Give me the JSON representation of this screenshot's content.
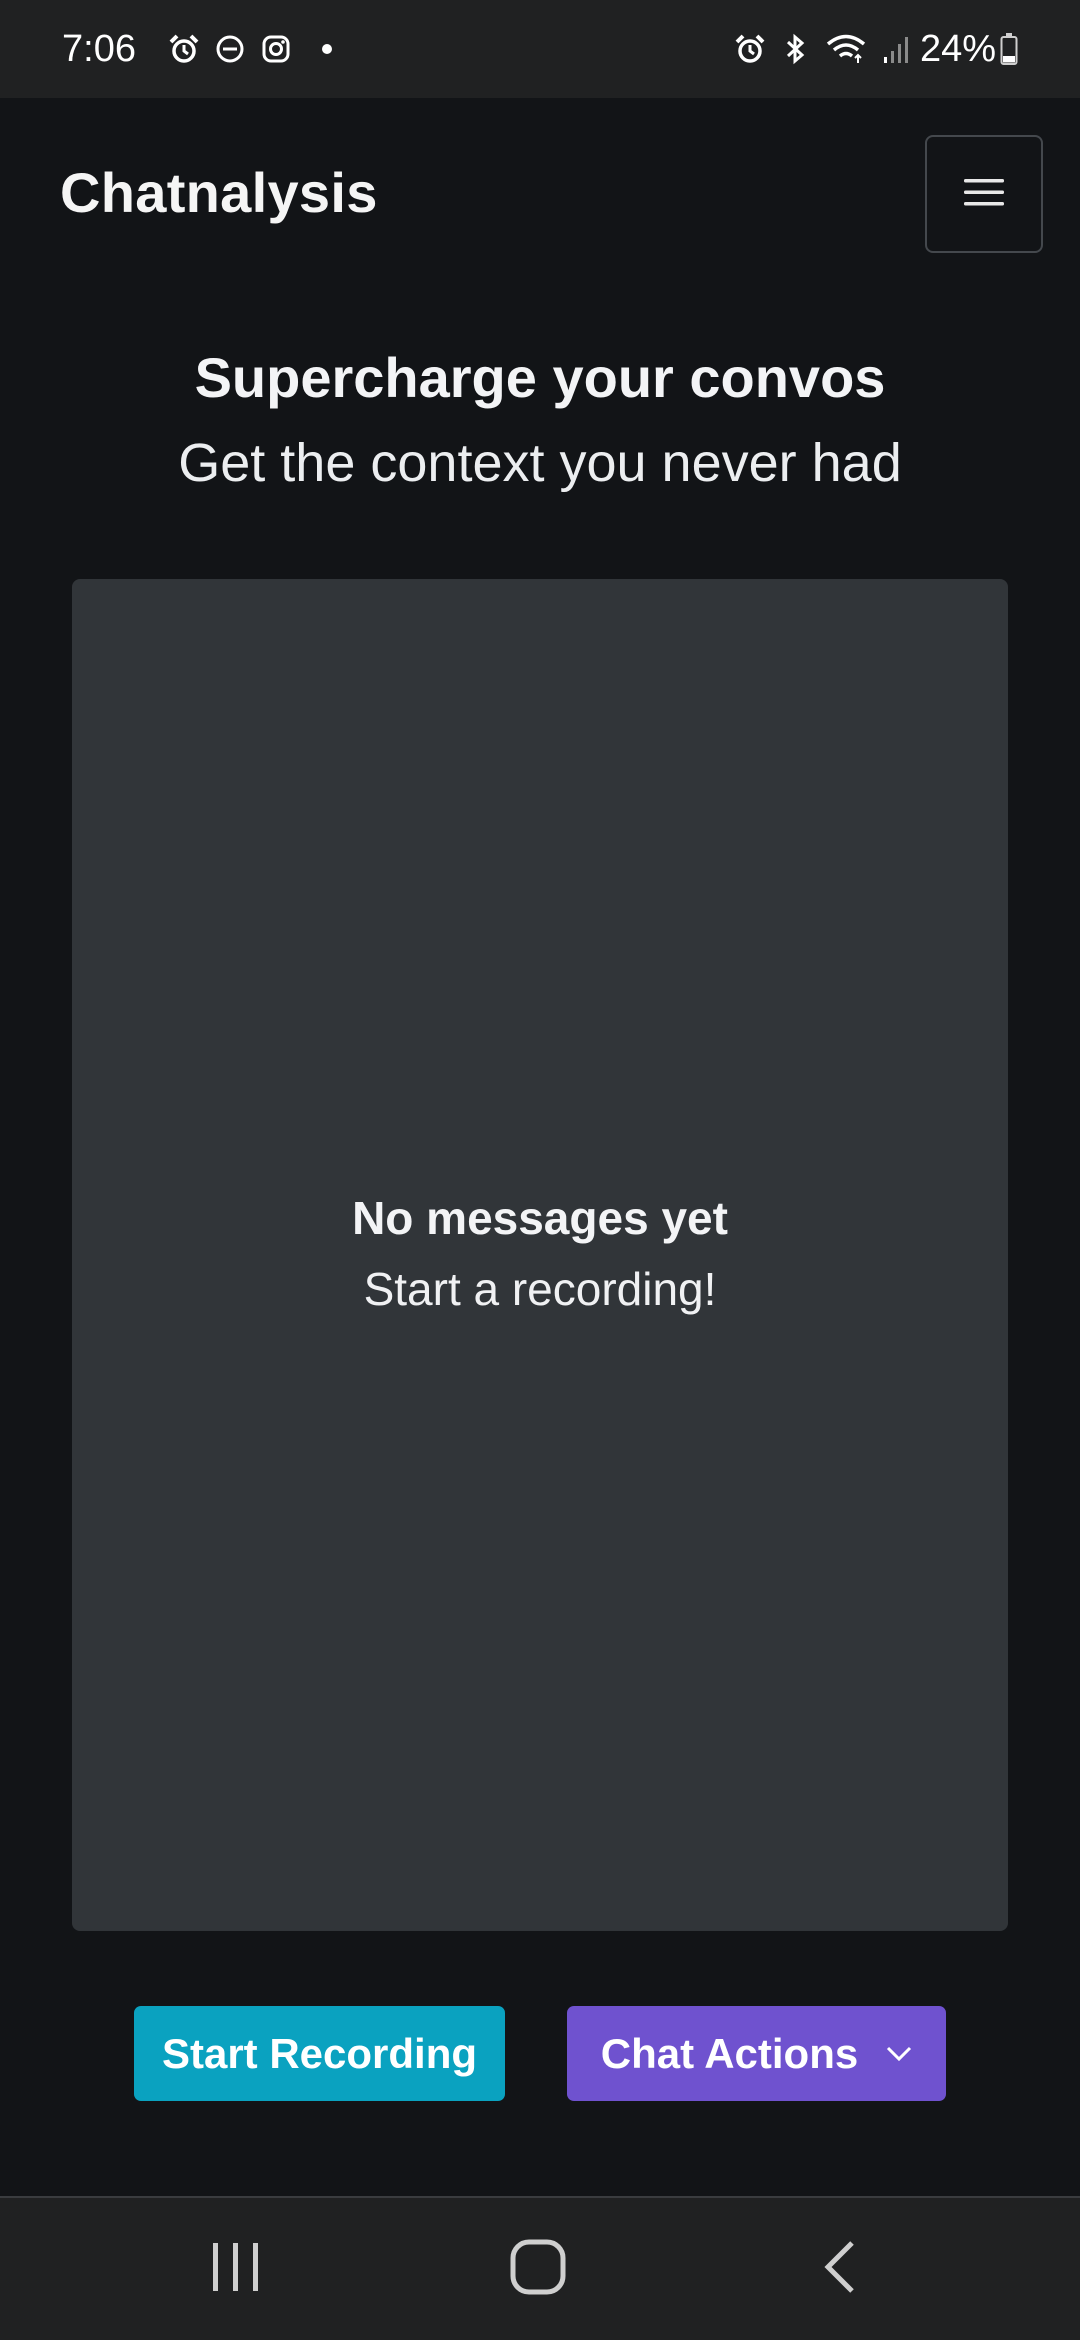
{
  "status_bar": {
    "time": "7:06",
    "battery_percent": "24%",
    "left_icons": [
      "alarm-icon",
      "do-not-disturb-icon",
      "instagram-icon",
      "notification-dot-icon"
    ],
    "right_icons": [
      "alarm-icon",
      "bluetooth-icon",
      "wifi-icon",
      "signal-icon",
      "battery-icon"
    ]
  },
  "navbar": {
    "brand": "Chatnalysis",
    "menu_icon": "hamburger-menu-icon"
  },
  "hero": {
    "title": "Supercharge your convos",
    "subtitle": "Get the context you never had"
  },
  "chat": {
    "empty_title": "No messages yet",
    "empty_subtitle": "Start a recording!"
  },
  "actions": {
    "start_recording_label": "Start Recording",
    "chat_actions_label": "Chat Actions"
  },
  "system_nav": {
    "icons": [
      "recent-apps-icon",
      "home-icon",
      "back-icon"
    ]
  },
  "colors": {
    "background": "#121417",
    "panel": "#313539",
    "status_bar": "#202122",
    "start_recording": "#0aa2c0",
    "chat_actions": "#6f52cf",
    "text": "#f3f4f6"
  }
}
